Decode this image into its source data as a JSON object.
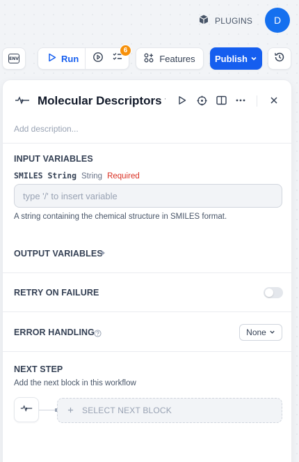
{
  "header": {
    "plugins_label": "PLUGINS",
    "avatar_initial": "D"
  },
  "toolbar": {
    "env_label": "ENV",
    "run_label": "Run",
    "checklist_badge": "6",
    "features_label": "Features",
    "publish_label": "Publish"
  },
  "panel": {
    "title": "Molecular Descriptors from SMILES",
    "description_placeholder": "Add description...",
    "input_variables": {
      "heading": "INPUT VARIABLES",
      "variable_name": "SMILES String",
      "variable_type": "String",
      "required_label": "Required",
      "input_placeholder": "type '/' to insert variable",
      "help_text": "A string containing the chemical structure in SMILES format."
    },
    "output_variables": {
      "heading": "OUTPUT VARIABLES"
    },
    "retry": {
      "heading": "RETRY ON FAILURE",
      "enabled": false
    },
    "error_handling": {
      "heading": "ERROR HANDLING",
      "selected": "None"
    },
    "next_step": {
      "heading": "NEXT STEP",
      "subtitle": "Add the next block in this workflow",
      "select_label": "SELECT NEXT BLOCK"
    }
  },
  "colors": {
    "accent": "#155eef",
    "avatar": "#1570ef",
    "badge": "#f79009",
    "required": "#d92d20"
  }
}
